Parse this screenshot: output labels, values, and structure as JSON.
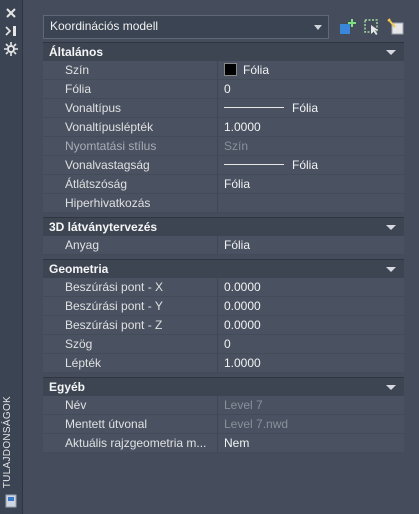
{
  "palette_title": "TULAJDONSÁGOK",
  "selector": {
    "value": "Koordinációs modell"
  },
  "sections": {
    "general": {
      "title": "Általános",
      "rows": [
        {
          "label": "Szín",
          "value": "Fólia"
        },
        {
          "label": "Fólia",
          "value": "0"
        },
        {
          "label": "Vonaltípus",
          "value": "Fólia"
        },
        {
          "label": "Vonaltípuslépték",
          "value": "1.0000"
        },
        {
          "label": "Nyomtatási stílus",
          "value": "Szín"
        },
        {
          "label": "Vonalvastagság",
          "value": "Fólia"
        },
        {
          "label": "Átlátszóság",
          "value": "Fólia"
        },
        {
          "label": "Hiperhivatkozás",
          "value": ""
        }
      ]
    },
    "vis3d": {
      "title": "3D látványtervezés",
      "rows": [
        {
          "label": "Anyag",
          "value": "Fólia"
        }
      ]
    },
    "geometry": {
      "title": "Geometria",
      "rows": [
        {
          "label": "Beszúrási pont - X",
          "value": "0.0000"
        },
        {
          "label": "Beszúrási pont - Y",
          "value": "0.0000"
        },
        {
          "label": "Beszúrási pont - Z",
          "value": "0.0000"
        },
        {
          "label": "Szög",
          "value": "0"
        },
        {
          "label": "Lépték",
          "value": "1.0000"
        }
      ]
    },
    "other": {
      "title": "Egyéb",
      "rows": [
        {
          "label": "Név",
          "value": "Level 7"
        },
        {
          "label": "Mentett útvonal",
          "value": "Level 7.nwd"
        },
        {
          "label": "Aktuális rajzgeometria m...",
          "value": "Nem"
        }
      ]
    }
  }
}
